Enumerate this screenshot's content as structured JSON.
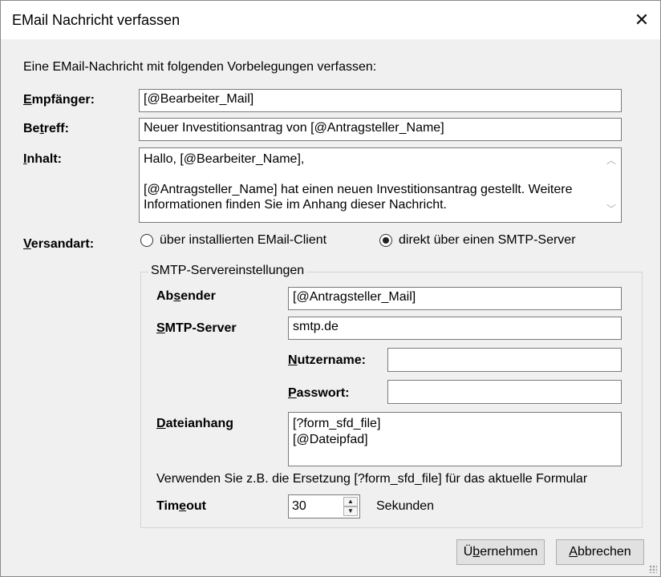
{
  "window": {
    "title": "EMail Nachricht verfassen",
    "close_glyph": "✕"
  },
  "intro": "Eine EMail-Nachricht mit folgenden Vorbelegungen verfassen:",
  "fields": {
    "empfaenger": {
      "label_u": "E",
      "label_rest": "mpfänger:",
      "value": "[@Bearbeiter_Mail]"
    },
    "betreff": {
      "label_a": "Be",
      "label_u": "t",
      "label_b": "reff:",
      "value": "Neuer Investitionsantrag von [@Antragsteller_Name]"
    },
    "inhalt": {
      "label_u": "I",
      "label_rest": "nhalt:",
      "lines": [
        "Hallo, [@Bearbeiter_Name],",
        "",
        "[@Antragsteller_Name] hat einen neuen Investitionsantrag gestellt. Weitere",
        "Informationen finden Sie im Anhang dieser Nachricht."
      ]
    }
  },
  "versandart": {
    "label_u": "V",
    "label_rest": "ersandart:",
    "options": [
      {
        "label": "über installierten EMail-Client",
        "checked": false
      },
      {
        "label": "direkt über einen SMTP-Server",
        "checked": true
      }
    ]
  },
  "smtp": {
    "group_title": "SMTP-Servereinstellungen",
    "absender": {
      "label_a": "Ab",
      "label_u": "s",
      "label_b": "ender",
      "value": "[@Antragsteller_Mail]"
    },
    "server": {
      "label_u": "S",
      "label_rest": "MTP-Server",
      "value": "smtp.de"
    },
    "nutzername": {
      "label_u": "N",
      "label_rest": "utzername:",
      "value": ""
    },
    "passwort": {
      "label_u": "P",
      "label_rest": "asswort:",
      "value": ""
    },
    "dateianhang": {
      "label_u": "D",
      "label_rest": "ateianhang",
      "lines": [
        "[?form_sfd_file]",
        "[@Dateipfad]"
      ]
    },
    "hint": "Verwenden Sie z.B. die Ersetzung [?form_sfd_file] für das aktuelle Formular",
    "timeout": {
      "label_a": "Tim",
      "label_u": "e",
      "label_b": "out",
      "value": "30",
      "unit": "Sekunden"
    }
  },
  "buttons": {
    "ok": {
      "label_a": "Ü",
      "label_u": "b",
      "label_b": "ernehmen"
    },
    "cancel": {
      "label_u": "A",
      "label_rest": "bbrechen"
    }
  }
}
